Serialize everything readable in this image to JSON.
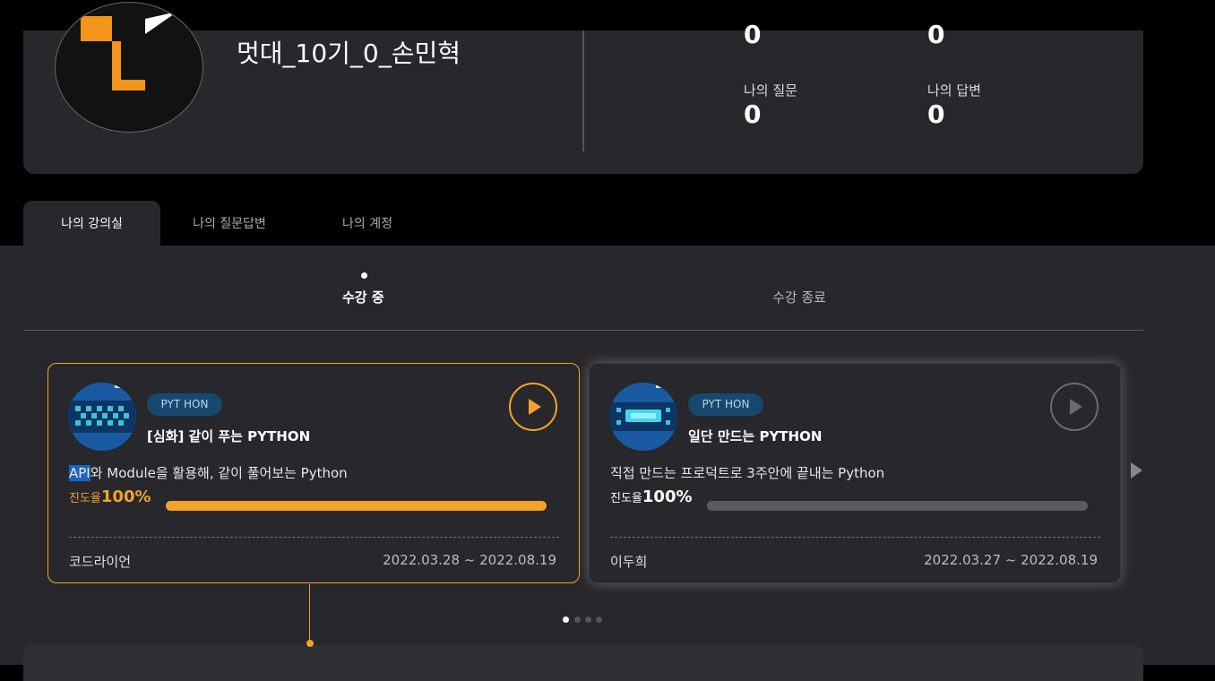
{
  "profile": {
    "username": "멋대_10기_0_손민혁",
    "stats_top": [
      "0",
      "0"
    ],
    "stats": [
      {
        "label": "나의 질문",
        "value": "0"
      },
      {
        "label": "나의 답변",
        "value": "0"
      }
    ]
  },
  "tabs": [
    {
      "label": "나의 강의실",
      "active": true
    },
    {
      "label": "나의 질문답변",
      "active": false
    },
    {
      "label": "나의 계정",
      "active": false
    }
  ],
  "subtabs": [
    {
      "label": "수강 중",
      "active": true
    },
    {
      "label": "수강 종료",
      "active": false
    }
  ],
  "courses": [
    {
      "badge": "PYT HON",
      "title": "[심화] 같이 푸는 PYTHON",
      "desc_highlight": "API",
      "desc_rest": "와 Module을 활용해, 같이 풀어보는 Python",
      "progress_label": "진도율",
      "progress_value": "100%",
      "progress_fraction": 1.0,
      "instructor": "코드라이언",
      "dates": "2022.03.28 ~ 2022.08.19",
      "accent": "#f3a32b",
      "play_icon": "play-circle-icon"
    },
    {
      "badge": "PYT HON",
      "title": "일단 만드는 PYTHON",
      "desc_highlight": "",
      "desc_rest": "직접 만드는 프로덕트로 3주안에 끝내는 Python",
      "progress_label": "진도율",
      "progress_value": "100%",
      "progress_fraction": 1.0,
      "instructor": "이두희",
      "dates": "2022.03.27 ~ 2022.08.19",
      "accent": "#5a5a62",
      "play_icon": "play-circle-icon"
    }
  ],
  "pager": {
    "count": 4,
    "active_index": 0
  },
  "colors": {
    "accent": "#f3a32b",
    "panel": "#27272c",
    "badge": "#17496e"
  }
}
